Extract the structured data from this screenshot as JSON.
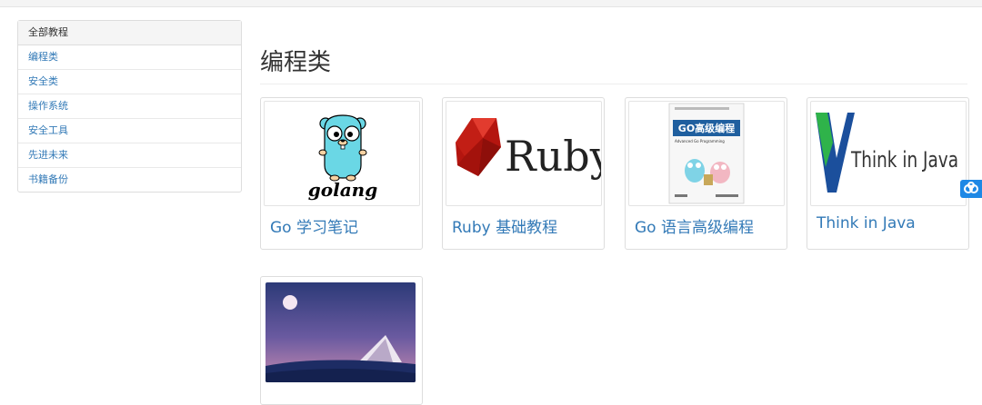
{
  "sidebar": {
    "header": "全部教程",
    "items": [
      {
        "label": "编程类"
      },
      {
        "label": "安全类"
      },
      {
        "label": "操作系统"
      },
      {
        "label": "安全工具"
      },
      {
        "label": "先进未来"
      },
      {
        "label": "书籍备份"
      }
    ]
  },
  "main": {
    "title": "编程类",
    "cards": [
      {
        "title": "Go 学习笔记",
        "logo_text": "golang"
      },
      {
        "title": "Ruby 基础教程",
        "logo_text": "Ruby"
      },
      {
        "title": "Go 语言高级编程",
        "cover_title": "GO高级编程",
        "cover_subtitle": "Advanced Go Programming"
      },
      {
        "title": "Think in Java",
        "logo_text": "Think in Java"
      },
      {
        "title": ""
      }
    ]
  },
  "colors": {
    "link": "#337ab7",
    "border": "#dddddd",
    "float_button": "#1e88e5"
  },
  "icons": {
    "float": "cloud-link-icon"
  }
}
